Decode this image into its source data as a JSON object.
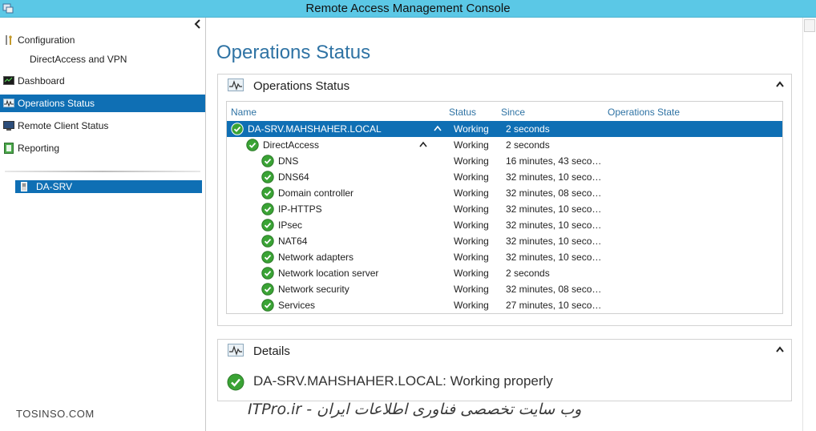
{
  "window": {
    "title": "Remote Access Management Console"
  },
  "nav": {
    "configuration": "Configuration",
    "directaccess_vpn": "DirectAccess and VPN",
    "dashboard": "Dashboard",
    "operations_status": "Operations Status",
    "remote_client_status": "Remote Client Status",
    "reporting": "Reporting",
    "server": "DA-SRV"
  },
  "main": {
    "page_title": "Operations Status",
    "ops_panel_title": "Operations Status",
    "details_panel_title": "Details",
    "details_message": "DA-SRV.MAHSHAHER.LOCAL: Working properly"
  },
  "grid": {
    "columns": {
      "name": "Name",
      "status": "Status",
      "since": "Since",
      "state": "Operations State"
    },
    "rows": [
      {
        "name": "DA-SRV.MAHSHAHER.LOCAL",
        "status": "Working",
        "since": "2 seconds"
      },
      {
        "name": "DirectAccess",
        "status": "Working",
        "since": "2 seconds"
      },
      {
        "name": "DNS",
        "status": "Working",
        "since": "16 minutes, 43 secon..."
      },
      {
        "name": "DNS64",
        "status": "Working",
        "since": "32 minutes, 10 secon..."
      },
      {
        "name": "Domain controller",
        "status": "Working",
        "since": "32 minutes, 08 secon..."
      },
      {
        "name": "IP-HTTPS",
        "status": "Working",
        "since": "32 minutes, 10 secon..."
      },
      {
        "name": "IPsec",
        "status": "Working",
        "since": "32 minutes, 10 secon..."
      },
      {
        "name": "NAT64",
        "status": "Working",
        "since": "32 minutes, 10 secon..."
      },
      {
        "name": "Network adapters",
        "status": "Working",
        "since": "32 minutes, 10 secon..."
      },
      {
        "name": "Network location server",
        "status": "Working",
        "since": "2 seconds"
      },
      {
        "name": "Network security",
        "status": "Working",
        "since": "32 minutes, 08 secon..."
      },
      {
        "name": "Services",
        "status": "Working",
        "since": "27 minutes, 10 secon..."
      }
    ]
  },
  "watermarks": {
    "left": "TOSINSO.COM",
    "bottom": "ITPro.ir - وب سایت تخصصی فناوری اطلاعات ایران"
  },
  "colors": {
    "accent": "#0f6fb4",
    "titlebar": "#5bc8e6",
    "heading": "#2f73a4",
    "ok_green": "#3aa335"
  }
}
